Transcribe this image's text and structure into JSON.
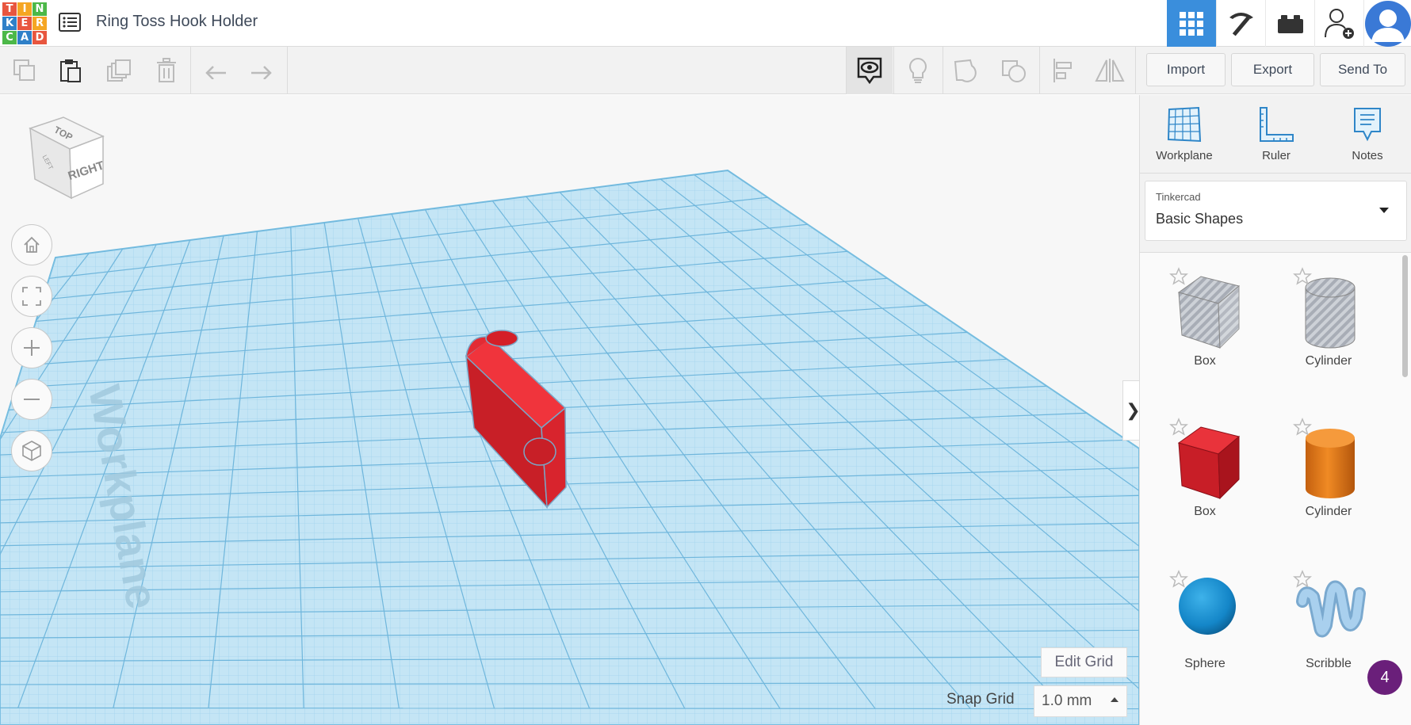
{
  "app": {
    "logo_letters": [
      "T",
      "I",
      "N",
      "K",
      "E",
      "R",
      "C",
      "A",
      "D"
    ],
    "logo_colors": [
      "#e8563f",
      "#f5a623",
      "#4cb848",
      "#2f80c8",
      "#e8563f",
      "#f5a623",
      "#4cb848",
      "#2f80c8",
      "#e8563f"
    ],
    "design_title": "Ring Toss Hook Holder",
    "accent_color": "#3a8edc"
  },
  "topbar": {
    "view_buttons": [
      {
        "name": "3d-design",
        "icon": "grid-icon",
        "active": true
      },
      {
        "name": "blocks",
        "icon": "pickaxe-icon",
        "active": false
      },
      {
        "name": "bricks",
        "icon": "brick-icon",
        "active": false
      }
    ],
    "invite_icon": "add-user-icon",
    "avatar_icon": "avatar-icon"
  },
  "toolbar": {
    "edit_tools": [
      "copy-icon",
      "paste-icon",
      "duplicate-icon",
      "delete-icon",
      "undo-icon",
      "redo-icon"
    ],
    "view_tools": [
      "notes-visibility-icon",
      "lightbulb-icon",
      "group-icon",
      "ungroup-icon",
      "align-icon",
      "mirror-icon"
    ],
    "import_label": "Import",
    "export_label": "Export",
    "send_to_label": "Send To"
  },
  "viewport": {
    "workplane_text": "Workplane",
    "view_cube": {
      "top": "TOP",
      "front": "LEFT",
      "right": "RIGHT"
    },
    "nav_buttons": [
      "home-icon",
      "fit-view-icon",
      "zoom-in-icon",
      "zoom-out-icon",
      "perspective-icon"
    ],
    "edit_grid_label": "Edit Grid",
    "snap_grid_label": "Snap Grid",
    "snap_grid_value": "1.0 mm",
    "object_color": "#e0252e"
  },
  "panel": {
    "tools": [
      {
        "label": "Workplane",
        "icon": "workplane-icon"
      },
      {
        "label": "Ruler",
        "icon": "ruler-icon"
      },
      {
        "label": "Notes",
        "icon": "notes-icon"
      }
    ],
    "library_source": "Tinkercad",
    "library_name": "Basic Shapes",
    "shapes": [
      {
        "label": "Box",
        "kind": "box-hole"
      },
      {
        "label": "Cylinder",
        "kind": "cylinder-hole"
      },
      {
        "label": "Box",
        "kind": "box"
      },
      {
        "label": "Cylinder",
        "kind": "cylinder"
      },
      {
        "label": "Sphere",
        "kind": "sphere"
      },
      {
        "label": "Scribble",
        "kind": "scribble"
      }
    ],
    "shape_colors": {
      "box": "#d81e2a",
      "cylinder": "#e67e1d",
      "sphere": "#1c8fd1",
      "scribble": "#9ec9ea",
      "hole": "#b4b8c0"
    }
  },
  "notifications": {
    "count": "4"
  }
}
